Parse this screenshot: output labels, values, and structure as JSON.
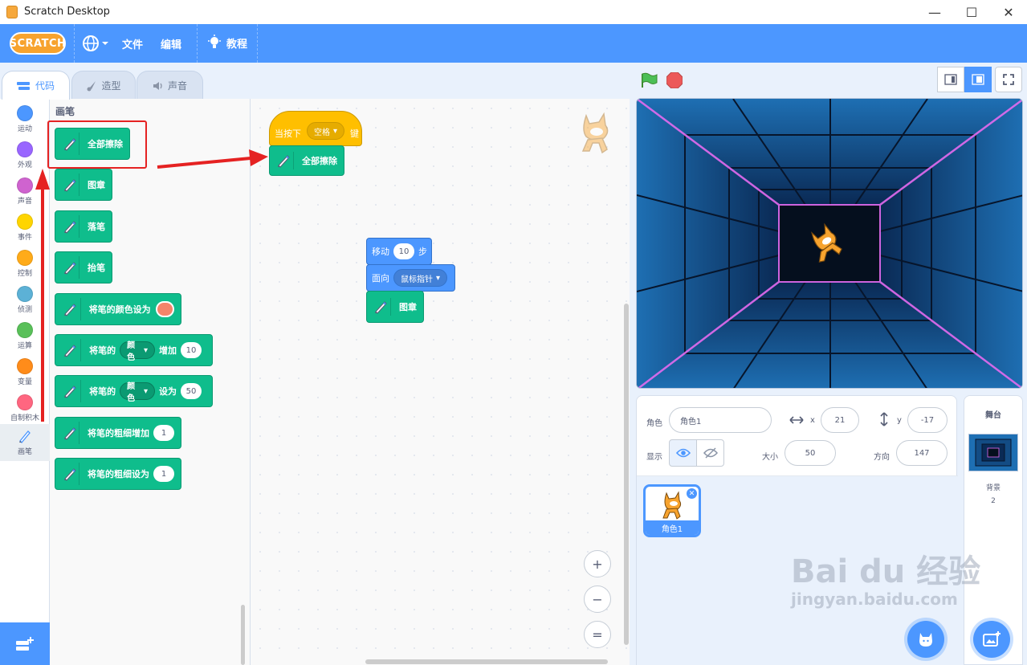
{
  "window": {
    "title": "Scratch Desktop",
    "minimize": "—",
    "maximize": "☐",
    "close": "✕"
  },
  "menubar": {
    "logo": "SCRATCH",
    "file": "文件",
    "edit": "编辑",
    "tutorials": "教程"
  },
  "tabs": {
    "code": "代码",
    "costumes": "造型",
    "sounds": "声音"
  },
  "categories": [
    {
      "label": "运动",
      "color": "#4c97ff"
    },
    {
      "label": "外观",
      "color": "#9966ff"
    },
    {
      "label": "声音",
      "color": "#cf63cf"
    },
    {
      "label": "事件",
      "color": "#ffd500"
    },
    {
      "label": "控制",
      "color": "#ffab19"
    },
    {
      "label": "侦测",
      "color": "#5cb1d6"
    },
    {
      "label": "运算",
      "color": "#59c059"
    },
    {
      "label": "变量",
      "color": "#ff8c1a"
    },
    {
      "label": "自制积木",
      "color": "#ff6680"
    },
    {
      "label": "画笔",
      "color": "#0fbd8c"
    }
  ],
  "palette": {
    "heading": "画笔",
    "erase_all": "全部擦除",
    "stamp": "图章",
    "pen_down": "落笔",
    "pen_up": "抬笔",
    "set_color_to": "将笔的颜色设为",
    "change_prefix": "将笔的",
    "change_param": "颜色",
    "change_suffix": "增加",
    "change_value": "10",
    "set_prefix": "将笔的",
    "set_param": "颜色",
    "set_suffix": "设为",
    "set_value": "50",
    "change_size": "将笔的粗细增加",
    "change_size_value": "1",
    "set_size": "将笔的粗细设为",
    "set_size_value": "1"
  },
  "script": {
    "hat_prefix": "当按下",
    "hat_key": "空格",
    "hat_suffix": "键",
    "erase_all": "全部擦除",
    "move_prefix": "移动",
    "move_value": "10",
    "move_suffix": "步",
    "point_prefix": "面向",
    "point_target": "鼠标指针",
    "stamp": "图章"
  },
  "zoom": {
    "in": "+",
    "out": "−",
    "reset": "="
  },
  "sprite": {
    "sprite_label": "角色",
    "sprite_name": "角色1",
    "x_label": "x",
    "x_value": "21",
    "y_label": "y",
    "y_value": "-17",
    "show_label": "显示",
    "size_label": "大小",
    "size_value": "50",
    "direction_label": "方向",
    "direction_value": "147",
    "thumb_name": "角色1"
  },
  "stage_panel": {
    "heading": "舞台",
    "backdrop_label": "背景",
    "backdrop_count": "2"
  },
  "watermark": {
    "brand": "Bai du 经验",
    "url": "jingyan.baidu.com"
  }
}
